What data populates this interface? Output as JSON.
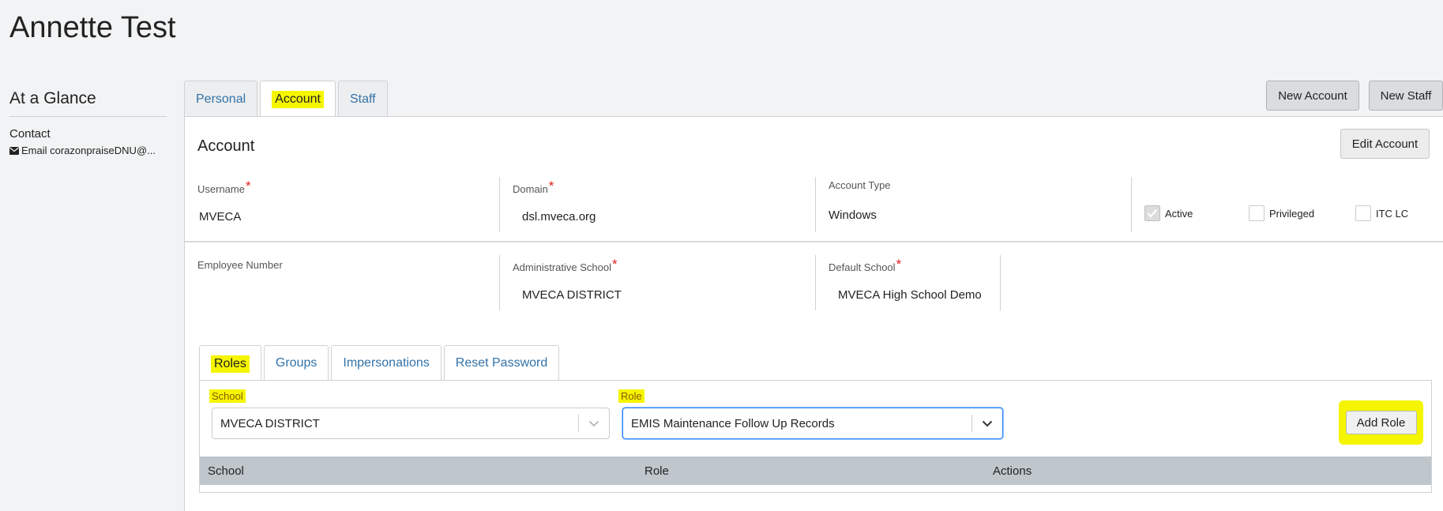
{
  "page_title": "Annette Test",
  "sidebar": {
    "heading": "At a Glance",
    "contact_label": "Contact",
    "email_text": "Email corazonpraiseDNU@..."
  },
  "main_tabs": [
    "Personal",
    "Account",
    "Staff"
  ],
  "main_tabs_active": "Account",
  "top_buttons": {
    "new_account": "New Account",
    "new_staff": "New Staff"
  },
  "account": {
    "title": "Account",
    "edit_button": "Edit Account",
    "fields": {
      "username": {
        "label": "Username",
        "value": "MVECA",
        "required": "*"
      },
      "domain": {
        "label": "Domain",
        "value": "dsl.mveca.org",
        "required": "*"
      },
      "account_type": {
        "label": "Account Type",
        "value": "Windows"
      },
      "employee_number": {
        "label": "Employee Number",
        "value": ""
      },
      "administrative_school": {
        "label": "Administrative School",
        "value": "MVECA DISTRICT",
        "required": "*"
      },
      "default_school": {
        "label": "Default School",
        "value": "MVECA High School Demo",
        "required": "*"
      }
    },
    "checkboxes": [
      {
        "label": "Active",
        "checked": true
      },
      {
        "label": "Privileged",
        "checked": false
      },
      {
        "label": "ITC LC",
        "checked": false
      }
    ]
  },
  "sub_tabs": [
    "Roles",
    "Groups",
    "Impersonations",
    "Reset Password"
  ],
  "sub_tabs_active": "Roles",
  "roles": {
    "school_label": "School",
    "school_value": "MVECA DISTRICT",
    "role_label": "Role",
    "role_value": "EMIS Maintenance Follow Up Records",
    "add_button": "Add Role",
    "table_headers": [
      "School",
      "Role",
      "Actions"
    ]
  },
  "colors": {
    "highlight": "#f5f500",
    "link": "#3272a8",
    "required": "#e02020",
    "table_header": "#bfc6cc",
    "focus": "#2684ff"
  }
}
